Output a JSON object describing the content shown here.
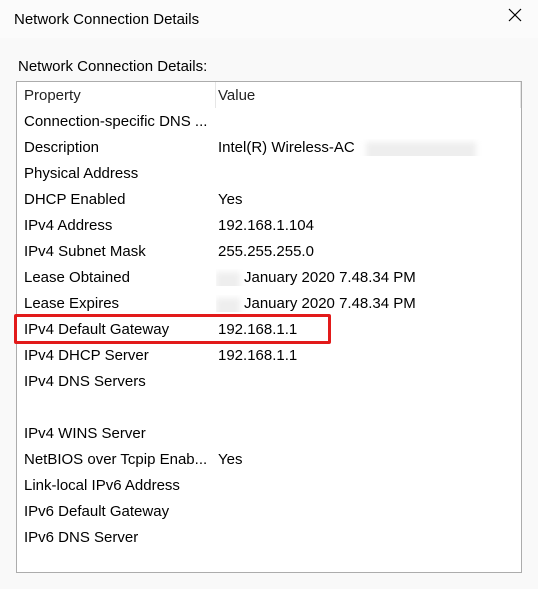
{
  "window": {
    "title": "Network Connection Details"
  },
  "body": {
    "label": "Network Connection Details:"
  },
  "headers": {
    "property": "Property",
    "value": "Value"
  },
  "rows": [
    {
      "prop": "Connection-specific DNS ...",
      "val": ""
    },
    {
      "prop": "Description",
      "val": "Intel(R) Wireless-AC",
      "redact_after": true
    },
    {
      "prop": "Physical Address",
      "val": "",
      "redact_value": true
    },
    {
      "prop": "DHCP Enabled",
      "val": "Yes"
    },
    {
      "prop": "IPv4 Address",
      "val": "192.168.1.104"
    },
    {
      "prop": "IPv4 Subnet Mask",
      "val": "255.255.255.0"
    },
    {
      "prop": "Lease Obtained",
      "val": "January 2020 7.48.34 PM",
      "redact_before": true
    },
    {
      "prop": "Lease Expires",
      "val": "January 2020 7.48.34 PM",
      "redact_before": true
    },
    {
      "prop": "IPv4 Default Gateway",
      "val": "192.168.1.1",
      "highlight": true
    },
    {
      "prop": "IPv4 DHCP Server",
      "val": "192.168.1.1"
    },
    {
      "prop": "IPv4 DNS Servers",
      "val": "",
      "redact_value": true
    },
    {
      "prop": "",
      "val": "",
      "redact_value": true
    },
    {
      "prop": "IPv4 WINS Server",
      "val": ""
    },
    {
      "prop": "NetBIOS over Tcpip Enab...",
      "val": "Yes"
    },
    {
      "prop": "Link-local IPv6 Address",
      "val": "",
      "redact_value": true
    },
    {
      "prop": "IPv6 Default Gateway",
      "val": ""
    },
    {
      "prop": "IPv6 DNS Server",
      "val": ""
    }
  ]
}
